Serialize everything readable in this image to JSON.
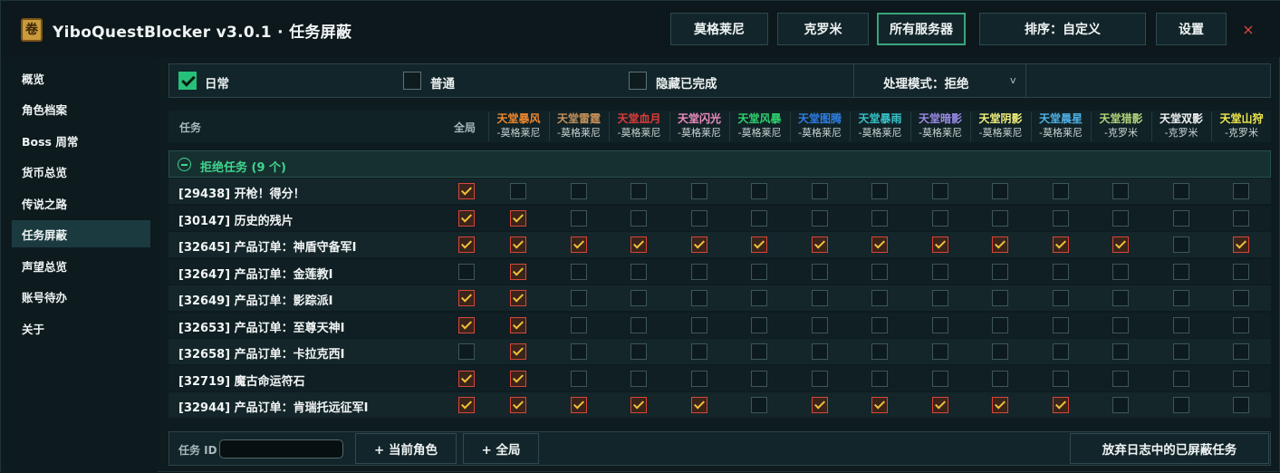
{
  "app": {
    "icon_glyph": "卷",
    "title": "YiboQuestBlocker v3.0.1 · 任务屏蔽"
  },
  "top_buttons": [
    {
      "label": "莫格莱尼",
      "active": false
    },
    {
      "label": "克罗米",
      "active": false
    },
    {
      "label": "所有服务器",
      "active": true
    },
    {
      "label": "排序：自定义",
      "active": false
    },
    {
      "label": "设置",
      "active": false
    }
  ],
  "close_glyph": "×",
  "sidebar": {
    "items": [
      {
        "label": "概览",
        "active": false
      },
      {
        "label": "角色档案",
        "active": false
      },
      {
        "label": "Boss 周常",
        "active": false
      },
      {
        "label": "货币总览",
        "active": false
      },
      {
        "label": "传说之路",
        "active": false
      },
      {
        "label": "任务屏蔽",
        "active": true
      },
      {
        "label": "声望总览",
        "active": false
      },
      {
        "label": "账号待办",
        "active": false
      },
      {
        "label": "关于",
        "active": false
      }
    ]
  },
  "filters": {
    "daily": {
      "label": "日常",
      "checked": true
    },
    "normal": {
      "label": "普通",
      "checked": false
    },
    "hide_completed": {
      "label": "隐藏已完成",
      "checked": false
    },
    "mode": {
      "label": "处理模式：拒绝",
      "arrow": "v"
    }
  },
  "table": {
    "task_header": "任务",
    "global_header": "全局",
    "columns": [
      {
        "name": "天堂暴风",
        "server": "-莫格莱尼",
        "color": "#f0892e"
      },
      {
        "name": "天堂雷霆",
        "server": "-莫格莱尼",
        "color": "#c9925a"
      },
      {
        "name": "天堂血月",
        "server": "-莫格莱尼",
        "color": "#e03a3a"
      },
      {
        "name": "天堂闪光",
        "server": "-莫格莱尼",
        "color": "#f08cc0"
      },
      {
        "name": "天堂风暴",
        "server": "-莫格莱尼",
        "color": "#2fd46e"
      },
      {
        "name": "天堂图腾",
        "server": "-莫格莱尼",
        "color": "#2e7fe6"
      },
      {
        "name": "天堂暴雨",
        "server": "-莫格莱尼",
        "color": "#36c3c9"
      },
      {
        "name": "天堂暗影",
        "server": "-莫格莱尼",
        "color": "#9c8ae8"
      },
      {
        "name": "天堂阴影",
        "server": "-莫格莱尼",
        "color": "#f2f07a"
      },
      {
        "name": "天堂晨星",
        "server": "-莫格莱尼",
        "color": "#4fb3e6"
      },
      {
        "name": "天堂猎影",
        "server": "-克罗米",
        "color": "#b3d47a"
      },
      {
        "name": "天堂双影",
        "server": "-克罗米",
        "color": "#f2f2f2"
      },
      {
        "name": "天堂山狩",
        "server": "-克罗米",
        "color": "#f2e84a"
      }
    ],
    "group": {
      "label": "拒绝任务 (9 个)"
    },
    "rows": [
      {
        "label": "[29438] 开枪！得分！",
        "global": true,
        "checks": [
          false,
          false,
          false,
          false,
          false,
          false,
          false,
          false,
          false,
          false,
          false,
          false,
          false
        ]
      },
      {
        "label": "[30147] 历史的残片",
        "global": true,
        "checks": [
          true,
          false,
          false,
          false,
          false,
          false,
          false,
          false,
          false,
          false,
          false,
          false,
          false
        ]
      },
      {
        "label": "[32645] 产品订单：神盾守备军I",
        "global": true,
        "checks": [
          true,
          true,
          true,
          true,
          true,
          true,
          true,
          true,
          true,
          true,
          true,
          false,
          true
        ]
      },
      {
        "label": "[32647] 产品订单：金莲教I",
        "global": false,
        "checks": [
          true,
          false,
          false,
          false,
          false,
          false,
          false,
          false,
          false,
          false,
          false,
          false,
          false
        ]
      },
      {
        "label": "[32649] 产品订单：影踪派I",
        "global": true,
        "checks": [
          true,
          false,
          false,
          false,
          false,
          false,
          false,
          false,
          false,
          false,
          false,
          false,
          false
        ]
      },
      {
        "label": "[32653] 产品订单：至尊天神I",
        "global": true,
        "checks": [
          true,
          false,
          false,
          false,
          false,
          false,
          false,
          false,
          false,
          false,
          false,
          false,
          false
        ]
      },
      {
        "label": "[32658] 产品订单：卡拉克西I",
        "global": false,
        "checks": [
          true,
          false,
          false,
          false,
          false,
          false,
          false,
          false,
          false,
          false,
          false,
          false,
          false
        ]
      },
      {
        "label": "[32719] 魔古命运符石",
        "global": true,
        "checks": [
          true,
          false,
          false,
          false,
          false,
          false,
          false,
          false,
          false,
          false,
          false,
          false,
          false
        ]
      },
      {
        "label": "[32944] 产品订单：肯瑞托远征军I",
        "global": true,
        "checks": [
          true,
          true,
          true,
          true,
          false,
          true,
          true,
          true,
          true,
          true,
          false,
          false,
          false
        ]
      }
    ]
  },
  "bottom": {
    "task_id_label": "任务 ID",
    "task_id_value": "",
    "add_current": "+ 当前角色",
    "add_global": "+ 全局",
    "abandon": "放弃日志中的已屏蔽任务"
  }
}
